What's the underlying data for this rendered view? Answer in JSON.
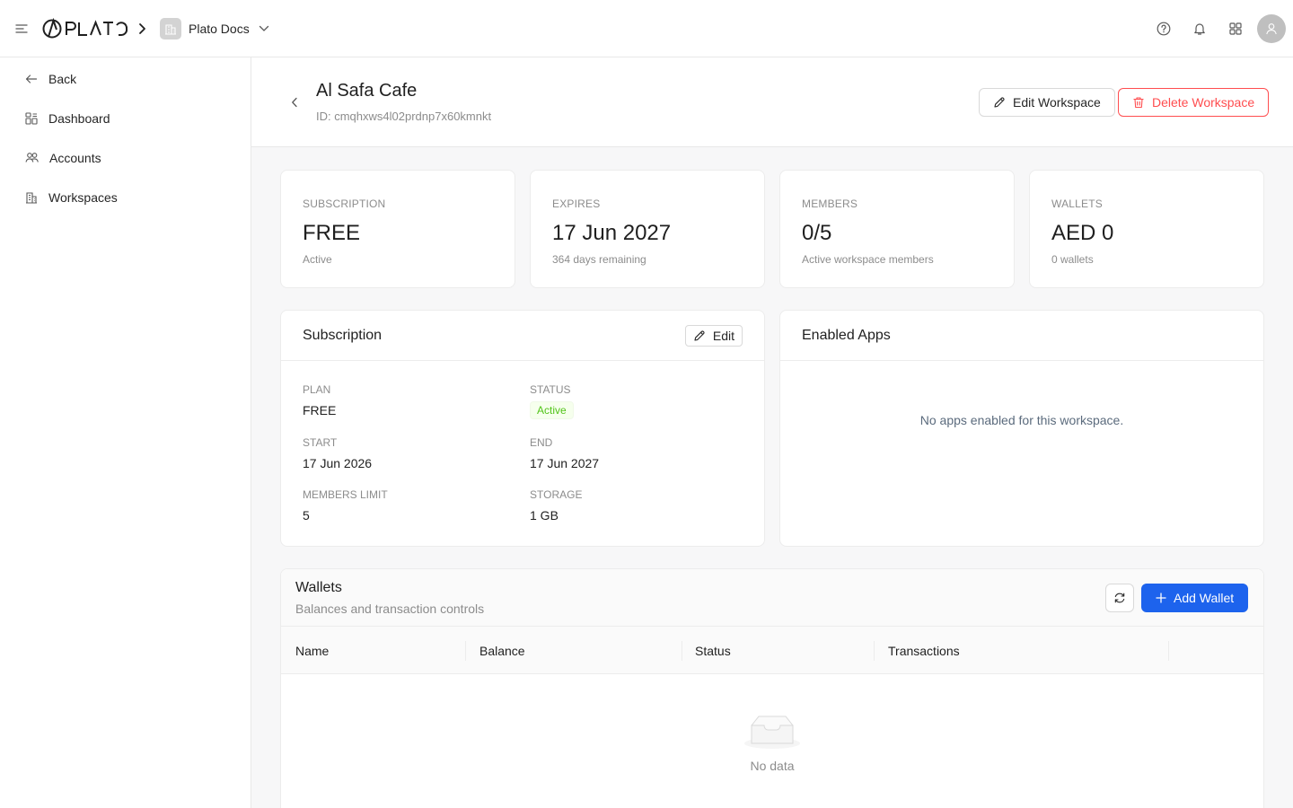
{
  "topbar": {
    "logo_text": "PLATO",
    "org_name": "Plato Docs"
  },
  "sidebar": {
    "items": [
      {
        "label": "Back",
        "icon": "arrow-left-icon"
      },
      {
        "label": "Dashboard",
        "icon": "dashboard-icon"
      },
      {
        "label": "Accounts",
        "icon": "users-icon"
      },
      {
        "label": "Workspaces",
        "icon": "building-icon"
      }
    ]
  },
  "header": {
    "title": "Al Safa Cafe",
    "id_text": "ID: cmqhxws4l02prdnp7x60kmnkt",
    "edit_label": "Edit Workspace",
    "delete_label": "Delete Workspace"
  },
  "stats": [
    {
      "label": "SUBSCRIPTION",
      "value": "FREE",
      "sub": "Active"
    },
    {
      "label": "EXPIRES",
      "value": "17 Jun 2027",
      "sub": "364 days remaining"
    },
    {
      "label": "MEMBERS",
      "value": "0/5",
      "sub": "Active workspace members"
    },
    {
      "label": "WALLETS",
      "value": "AED 0",
      "sub": "0 wallets"
    }
  ],
  "subscription": {
    "title": "Subscription",
    "edit_label": "Edit",
    "plan_label": "PLAN",
    "plan_value": "FREE",
    "status_label": "STATUS",
    "status_value": "Active",
    "start_label": "START",
    "start_value": "17 Jun 2026",
    "end_label": "END",
    "end_value": "17 Jun 2027",
    "members_label": "MEMBERS LIMIT",
    "members_value": "5",
    "storage_label": "STORAGE",
    "storage_value": "1 GB"
  },
  "apps": {
    "title": "Enabled Apps",
    "empty_text": "No apps enabled for this workspace."
  },
  "wallets": {
    "title": "Wallets",
    "subtitle": "Balances and transaction controls",
    "add_label": "Add Wallet",
    "columns": [
      "Name",
      "Balance",
      "Status",
      "Transactions"
    ],
    "empty_text": "No data"
  },
  "colors": {
    "primary": "#1d63ed",
    "danger": "#ff4d4f",
    "success": "#52c41a"
  }
}
